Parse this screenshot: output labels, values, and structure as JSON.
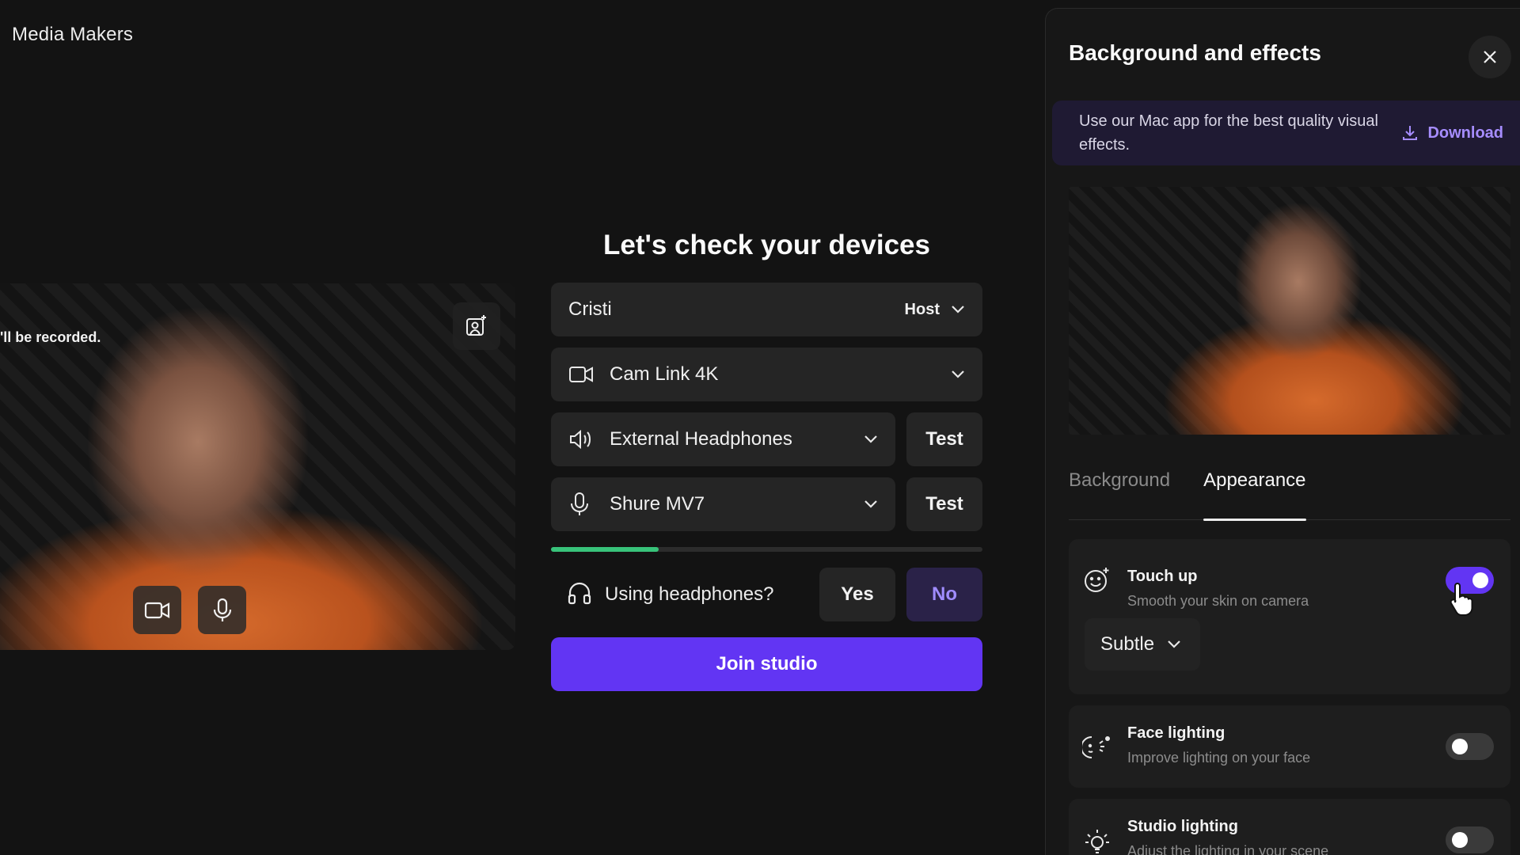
{
  "app": {
    "brand": "Media Makers"
  },
  "preview": {
    "recording_notice": "'ll be recorded.",
    "effects_icon": "image-sparkle-icon",
    "camera_icon": "camera-icon",
    "mic_icon": "microphone-icon"
  },
  "devices": {
    "heading": "Let's check your devices",
    "name": "Cristi",
    "role": "Host",
    "camera": "Cam Link 4K",
    "speaker": "External Headphones",
    "speaker_test": "Test",
    "microphone": "Shure MV7",
    "mic_test": "Test",
    "mic_level": 0.25,
    "headphones_question": "Using headphones?",
    "yes": "Yes",
    "no": "No",
    "selected_answer": "No",
    "join": "Join studio"
  },
  "panel": {
    "title": "Background and effects",
    "banner_text": "Use our Mac app for the best quality visual effects.",
    "download": "Download",
    "tabs": [
      "Background",
      "Appearance"
    ],
    "active_tab": "Appearance",
    "effects": [
      {
        "title": "Touch up",
        "subtitle": "Smooth your skin on camera",
        "enabled": true,
        "level": "Subtle",
        "icon": "smile-sparkle-icon"
      },
      {
        "title": "Face lighting",
        "subtitle": "Improve lighting on your face",
        "enabled": false,
        "icon": "face-light-icon"
      },
      {
        "title": "Studio lighting",
        "subtitle": "Adjust the lighting in your scene",
        "enabled": false,
        "icon": "lightbulb-icon"
      }
    ]
  },
  "colors": {
    "accent": "#6235f3",
    "meter": "#38c37a",
    "background": "#131313",
    "panel": "#171717"
  }
}
